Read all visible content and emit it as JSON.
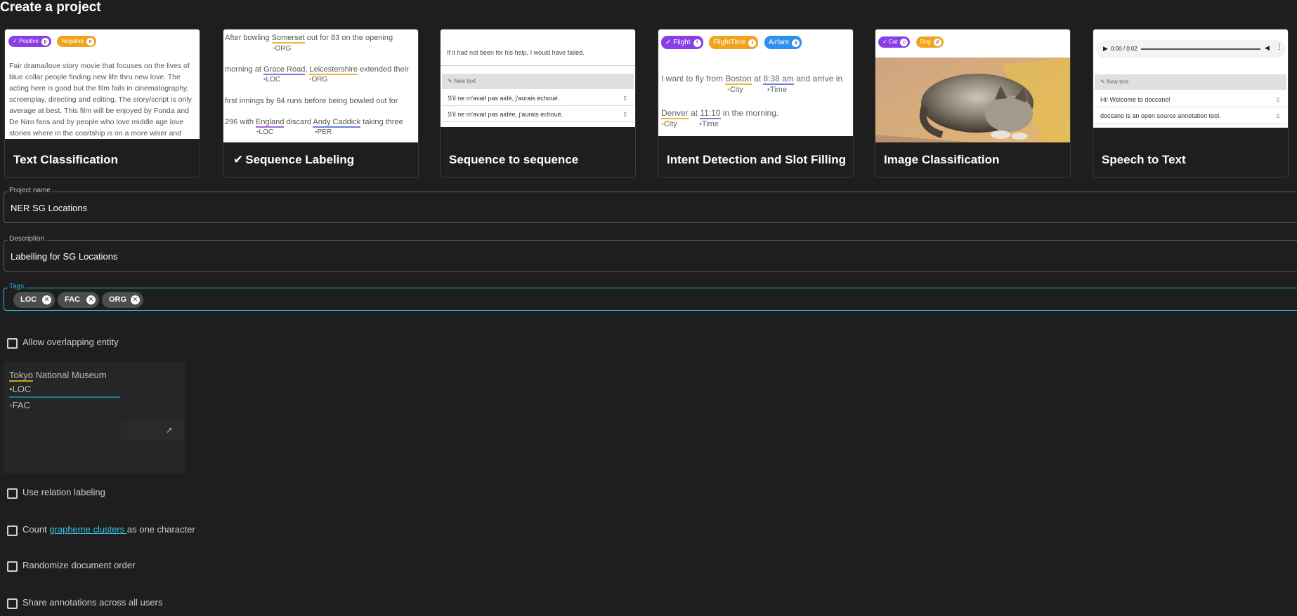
{
  "page": {
    "title": "Create a project"
  },
  "cards": [
    {
      "label": "Text Classification",
      "selected": false,
      "preview": {
        "chips": [
          {
            "label": "Positive",
            "key": "p",
            "color": "#8a3ee6",
            "checked": true
          },
          {
            "label": "Negative",
            "key": "n",
            "color": "#f2a31c",
            "checked": false
          }
        ],
        "text": "Fair drama/love story movie that focuses on the lives of blue collar people finding new life thru new love. The acting here is good but the film fails in cinematography, screenplay, directing and editing. The story/script is only average at best. This film will be enjoyed by Fonda and De Niro fans and by people who love middle age love stories where in the coartship is on a more wiser and cautious"
      }
    },
    {
      "label": "Sequence Labeling",
      "selected": true,
      "preview": {
        "l1a": "After bowling ",
        "l1b": "Somerset",
        "l1c": " out for 83 on the opening",
        "l1lab": "ORG",
        "l2a": "morning at ",
        "l2b": "Grace Road",
        "l2c": ", ",
        "l2d": "Leicestershire",
        "l2e": " extended their",
        "l2lab1": "LOC",
        "l2lab2": "ORG",
        "l3": "first innings by 94 runs before being bowled out for",
        "l4a": "296 with ",
        "l4b": "England",
        "l4c": " discard ",
        "l4d": "Andy Caddick",
        "l4e": " taking three",
        "l4lab1": "LOC",
        "l4lab2": "PER"
      }
    },
    {
      "label": "Sequence to sequence",
      "selected": false,
      "preview": {
        "source": "If it had not been for his help, I would have failed.",
        "new_text": "New text",
        "rows": [
          "S'il ne m'avait pas aidé, j'aurais échoué.",
          "S'il ne m'avait pas aidée, j'aurais échoué."
        ]
      }
    },
    {
      "label": "Intent Detection and Slot Filling",
      "selected": false,
      "preview": {
        "chips": [
          {
            "label": "Flight",
            "key": "f",
            "color": "#8a3ee6",
            "checked": true
          },
          {
            "label": "FlightTime",
            "key": "t",
            "color": "#f2a31c",
            "checked": false
          },
          {
            "label": "Airfare",
            "key": "a",
            "color": "#2d8ff0",
            "checked": false
          }
        ],
        "l1a": "I want to fly from ",
        "l1b": "Boston",
        "l1c": " at ",
        "l1d": "8:38 am",
        "l1e": " and arrive in",
        "l1lab1": "City",
        "l1lab2": "Time",
        "l2a": "Denver",
        "l2b": " at ",
        "l2c": "11:10",
        "l2d": " in the morning.",
        "l2lab1": "City",
        "l2lab2": "Time"
      }
    },
    {
      "label": "Image Classification",
      "selected": false,
      "preview": {
        "chips": [
          {
            "label": "Cat",
            "key": "c",
            "color": "#8a3ee6",
            "checked": true
          },
          {
            "label": "Dog",
            "key": "d",
            "color": "#f2a31c",
            "checked": false
          }
        ]
      }
    },
    {
      "label": "Speech to Text",
      "selected": false,
      "preview": {
        "time": "0:00 / 0:02",
        "new_text": "New text",
        "rows": [
          "Hi! Welcome to doccano!",
          "doccano is an open source annotation tool."
        ]
      }
    }
  ],
  "form": {
    "project_name": {
      "label": "Project name",
      "value": "NER SG Locations"
    },
    "description": {
      "label": "Description",
      "value": "Labelling for SG Locations"
    },
    "tags": {
      "label": "Tags",
      "items": [
        "LOC",
        "FAC",
        "ORG"
      ]
    }
  },
  "options": {
    "allow_overlapping": "Allow overlapping entity",
    "overlap_demo": {
      "text_a": "Tokyo",
      "text_b": " National Museum",
      "label1": "LOC",
      "label2": "FAC"
    },
    "relation_labeling": "Use relation labeling",
    "grapheme_a": "Count ",
    "grapheme_link": "grapheme clusters ",
    "grapheme_b": "as one character",
    "randomize": "Randomize document order",
    "share": "Share annotations across all users"
  },
  "colors": {
    "accent": "#2ab5d6",
    "purple": "#8a3ee6",
    "orange": "#f2a31c",
    "blue": "#2d8ff0"
  }
}
